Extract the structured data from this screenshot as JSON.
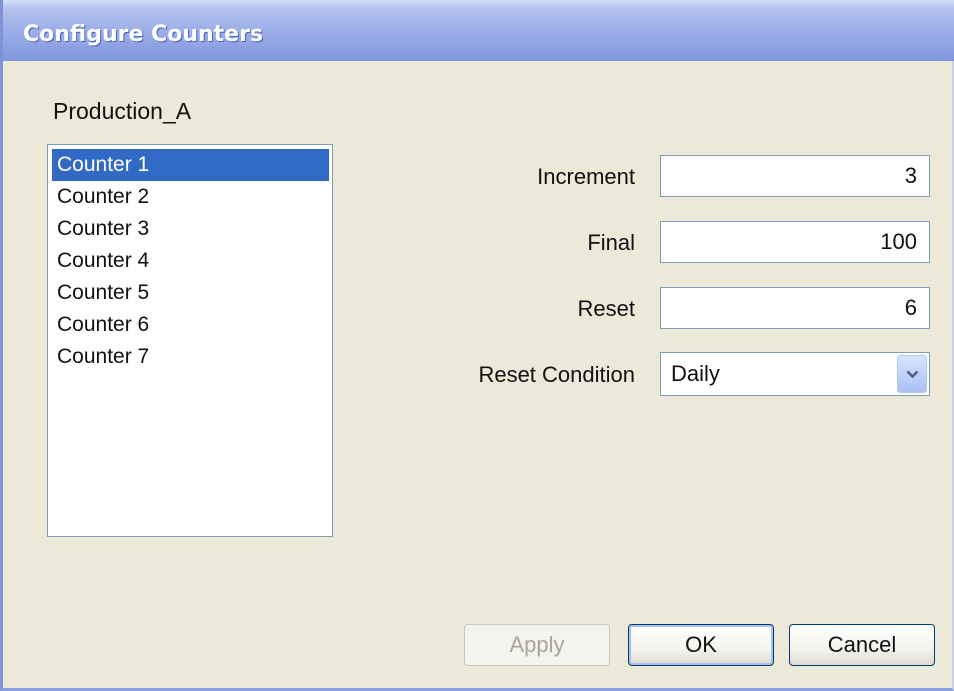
{
  "window": {
    "title": "Configure Counters"
  },
  "group": {
    "label": "Production_A"
  },
  "counters": {
    "items": [
      {
        "label": "Counter 1",
        "selected": true
      },
      {
        "label": "Counter 2",
        "selected": false
      },
      {
        "label": "Counter 3",
        "selected": false
      },
      {
        "label": "Counter 4",
        "selected": false
      },
      {
        "label": "Counter 5",
        "selected": false
      },
      {
        "label": "Counter 6",
        "selected": false
      },
      {
        "label": "Counter 7",
        "selected": false
      }
    ]
  },
  "fields": {
    "increment": {
      "label": "Increment",
      "value": "3"
    },
    "final": {
      "label": "Final",
      "value": "100"
    },
    "reset": {
      "label": "Reset",
      "value": "6"
    },
    "reset_condition": {
      "label": "Reset Condition",
      "value": "Daily"
    }
  },
  "buttons": {
    "apply": {
      "label": "Apply",
      "enabled": false
    },
    "ok": {
      "label": "OK",
      "enabled": true
    },
    "cancel": {
      "label": "Cancel",
      "enabled": true
    }
  },
  "colors": {
    "titlebar": "#8fa3e3",
    "dialog_bg": "#ECE9D8",
    "selection": "#316AC5"
  }
}
